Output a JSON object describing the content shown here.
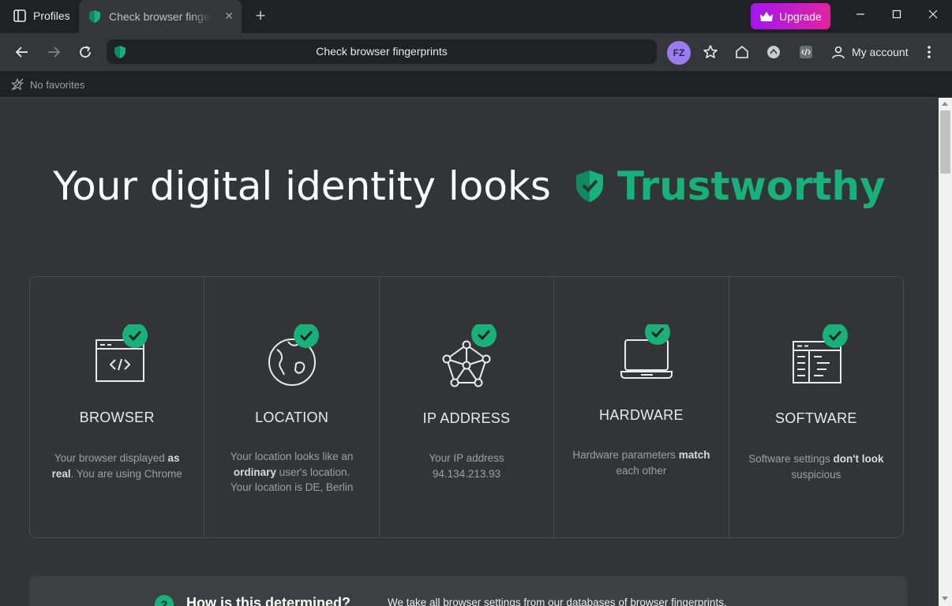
{
  "browser": {
    "profiles_label": "Profiles",
    "tab_title": "Check browser fingerprints",
    "tab_close": "✕",
    "new_tab": "+",
    "upgrade_label": "Upgrade",
    "omnibox_text": "Check browser fingerprints",
    "avatar_initials": "FZ",
    "account_label": "My account",
    "bookmarks_empty": "No favorites"
  },
  "hero": {
    "prefix": "Your digital identity looks",
    "status": "Trustworthy"
  },
  "cards": [
    {
      "title": "BROWSER",
      "desc_parts": [
        "Your browser displayed ",
        "as real",
        ". You are using Chrome"
      ]
    },
    {
      "title": "LOCATION",
      "desc_parts": [
        "Your location looks like an ",
        "ordinary",
        " user's location. Your location is DE, Berlin"
      ]
    },
    {
      "title": "IP ADDRESS",
      "desc_parts": [
        "Your IP address 94.134.213.93",
        "",
        ""
      ]
    },
    {
      "title": "HARDWARE",
      "desc_parts": [
        "Hardware parameters ",
        "match",
        " each other"
      ]
    },
    {
      "title": "SOFTWARE",
      "desc_parts": [
        "Software settings ",
        "don't look",
        " suspicious"
      ]
    }
  ],
  "info": {
    "icon": "?",
    "title": "How is this determined?",
    "text": "We take all browser settings from our databases of browser fingerprints."
  },
  "colors": {
    "accent_green": "#17b17a",
    "upgrade_start": "#a415ef",
    "upgrade_end": "#e2239f"
  }
}
